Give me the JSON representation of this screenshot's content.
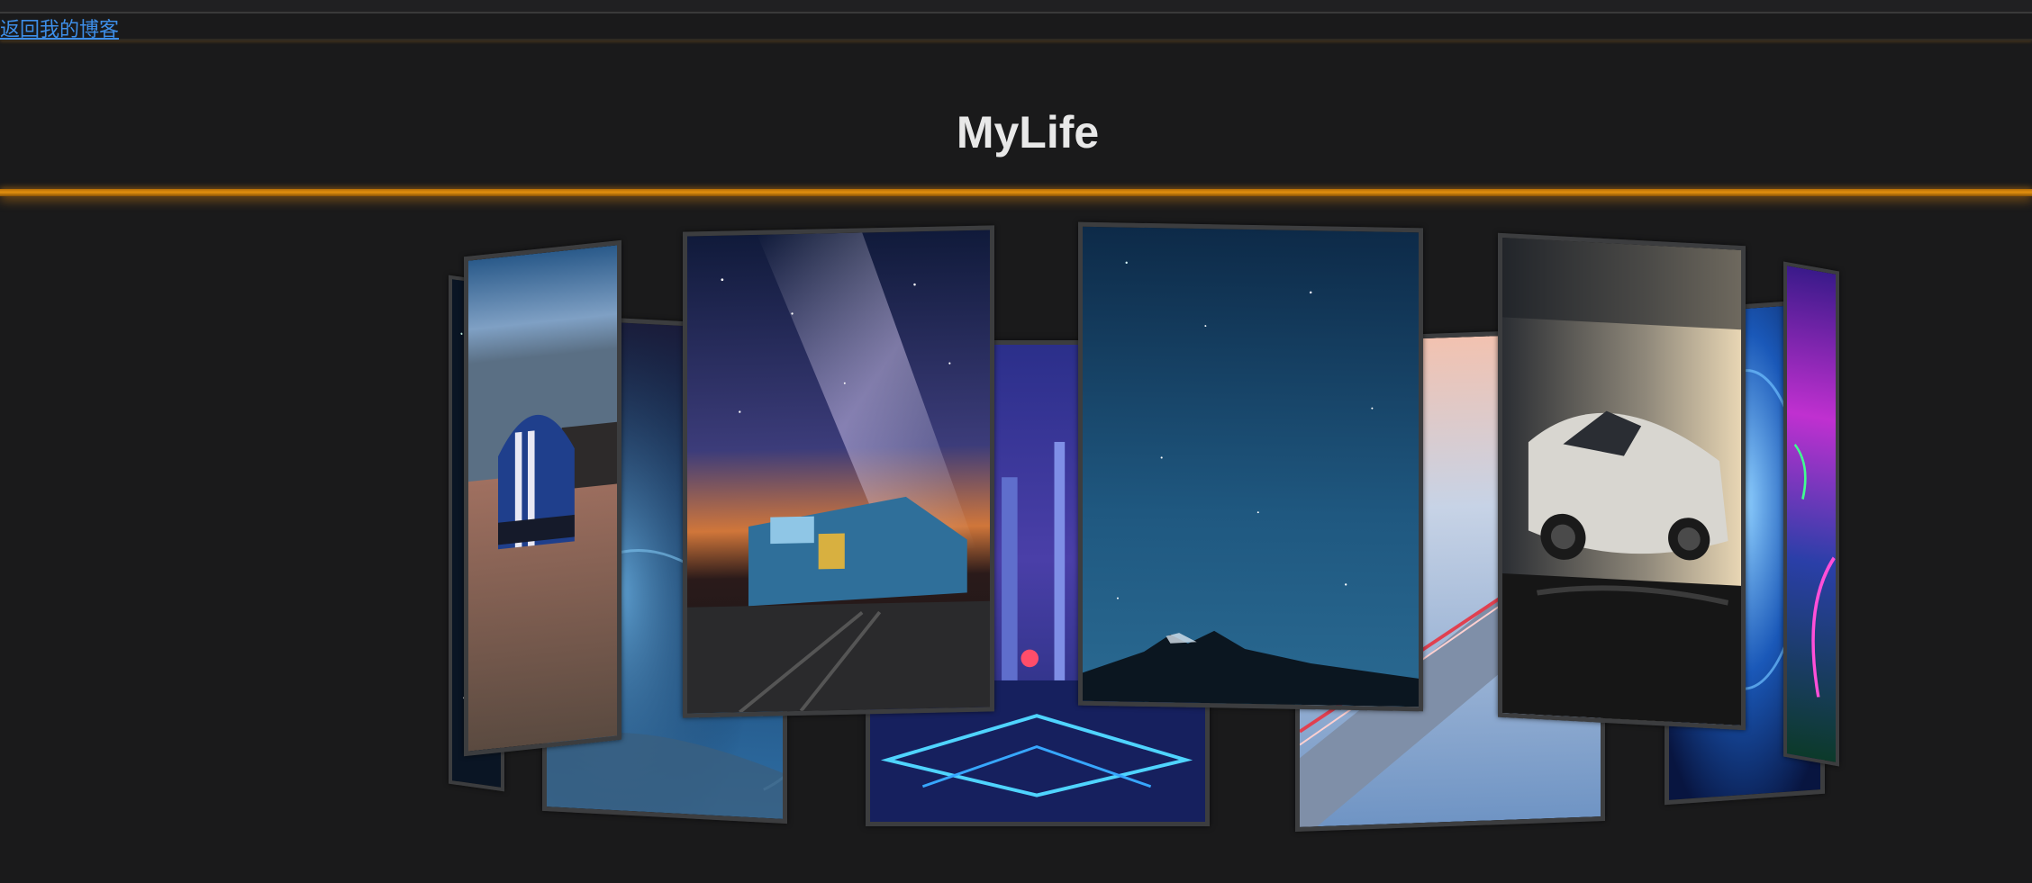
{
  "nav": {
    "back_label": "返回我的博客"
  },
  "header": {
    "title": "MyLife"
  },
  "carousel": {
    "accent_color": "#e3900f",
    "photos": [
      {
        "name": "photo-starry-sky-edge"
      },
      {
        "name": "photo-blue-mustang-car"
      },
      {
        "name": "photo-blue-abstract-swirl"
      },
      {
        "name": "photo-milky-way-train"
      },
      {
        "name": "photo-neon-city"
      },
      {
        "name": "photo-night-sky-mountain"
      },
      {
        "name": "photo-foggy-bridge"
      },
      {
        "name": "photo-white-supercar"
      },
      {
        "name": "photo-blue-tunnel"
      },
      {
        "name": "photo-neon-purple-abstract"
      }
    ]
  }
}
